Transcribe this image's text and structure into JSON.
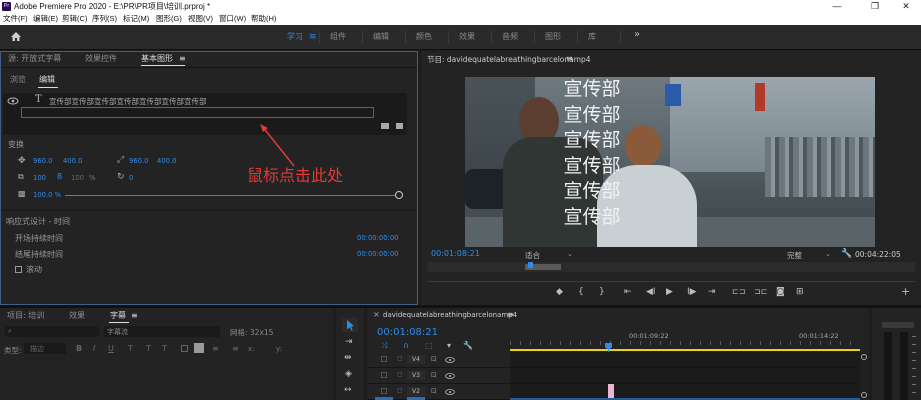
{
  "window": {
    "title": "Adobe Premiere Pro 2020 - E:\\PR\\PR项目\\培训.prproj *",
    "app_icon_text": "Pr",
    "minimize": "—",
    "restore": "❐",
    "close": "✕"
  },
  "menu": [
    "文件(F)",
    "编辑(E)",
    "剪辑(C)",
    "序列(S)",
    "标记(M)",
    "图形(G)",
    "视图(V)",
    "窗口(W)",
    "帮助(H)"
  ],
  "workspaces": [
    {
      "label": "学习",
      "active": true
    },
    {
      "label": "组件",
      "active": false
    },
    {
      "label": "编辑",
      "active": false
    },
    {
      "label": "颜色",
      "active": false
    },
    {
      "label": "效果",
      "active": false
    },
    {
      "label": "音频",
      "active": false
    },
    {
      "label": "图形",
      "active": false
    },
    {
      "label": "库",
      "active": false
    }
  ],
  "workspace_menu_glyph": "≡",
  "workspace_more": "»",
  "eg_panel": {
    "tabs": [
      "源: 开放式字幕",
      "效果控件",
      "基本图形"
    ],
    "subtabs": [
      "浏览",
      "编辑"
    ],
    "layer_text": "宣传部宣传部宣传部宣传部宣传部宣传部宣传部",
    "annotation": "鼠标点击此处",
    "transform_label": "变换",
    "pos_x": "960.0",
    "pos_y": "400.0",
    "anchor_x": "960.0",
    "anchor_y": "400.0",
    "scale": "100",
    "scale_extra": "100",
    "scale_pct": "%",
    "rotation": "0",
    "opacity": "100.0 %",
    "responsive_label": "响应式设计 - 时间",
    "intro_label": "开场持续时间",
    "intro_value": "00:00:00:00",
    "outro_label": "结尾持续时间",
    "outro_value": "00:00:00:00",
    "roll_label": "滚动"
  },
  "program": {
    "title": "节目: davidequatelabreathingbarcelonamp4",
    "menu_glyph": "≡",
    "overlay_text": [
      "宣传部",
      "宣传部",
      "宣传部",
      "宣传部",
      "宣传部",
      "宣传部"
    ],
    "timecode": "00:01:08:21",
    "fit": "适合",
    "quality": "完整",
    "duration": "00:04:22:05",
    "controls": [
      "◆",
      "{",
      "}",
      "⇤",
      "◀I",
      "▶",
      "I▶",
      "⇥",
      "⊏⊐",
      "⊐⊏",
      "◙",
      "⊞"
    ],
    "add": "+"
  },
  "project_panel": {
    "tabs": [
      "项目: 培训",
      "效果",
      "字幕"
    ],
    "search_placeholder": "",
    "style_label": "字幕流",
    "grid_label": "网格: 32x15",
    "type_label": "类型:",
    "type_value": "描边",
    "x_label": "x:",
    "y_label": "y:"
  },
  "timeline": {
    "tab": "davidequatelabreathingbarcelonamp4",
    "timecode": "00:01:08:21",
    "ruler": [
      "00:01:09:22",
      "00:01:14:22"
    ],
    "tracks": [
      "V4",
      "V3",
      "V2"
    ]
  },
  "colors": {
    "accent": "#2d8ceb",
    "annotation": "#e23a3a",
    "panel": "#232323",
    "app_bg": "#1d1d1d"
  },
  "icons": [
    "home-icon",
    "eye-icon",
    "text-tool-icon",
    "position-icon",
    "anchor-icon",
    "scale-icon",
    "link-icon",
    "rotation-icon",
    "opacity-icon",
    "selection-tool-icon",
    "wrench-icon",
    "lock-icon"
  ]
}
